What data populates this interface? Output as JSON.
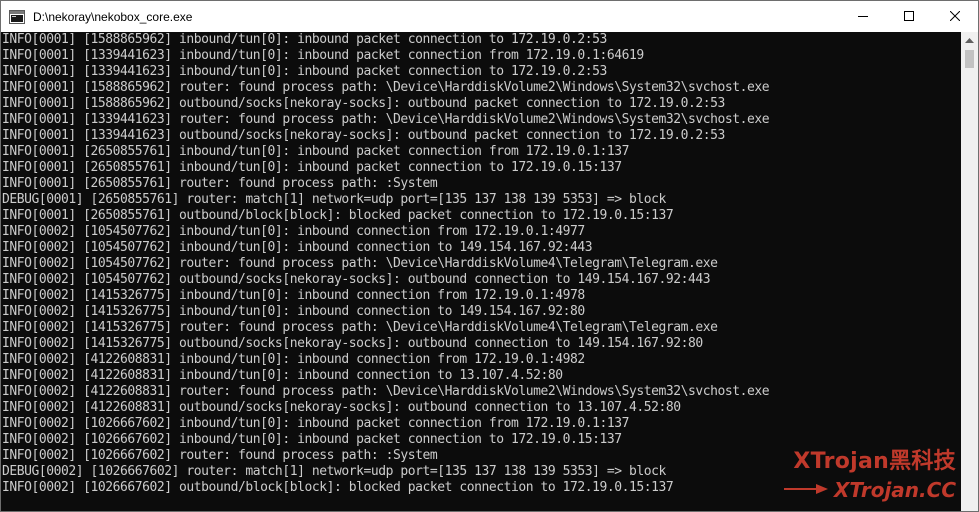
{
  "window": {
    "title": "D:\\nekoray\\nekobox_core.exe",
    "icon": "console-app-icon",
    "controls": [
      "minimize-icon",
      "maximize-icon",
      "close-icon"
    ]
  },
  "console": {
    "lines": [
      "INFO[0001] [1588865962] inbound/tun[0]: inbound packet connection to 172.19.0.2:53",
      "INFO[0001] [1339441623] inbound/tun[0]: inbound packet connection from 172.19.0.1:64619",
      "INFO[0001] [1339441623] inbound/tun[0]: inbound packet connection to 172.19.0.2:53",
      "INFO[0001] [1588865962] router: found process path: \\Device\\HarddiskVolume2\\Windows\\System32\\svchost.exe",
      "INFO[0001] [1588865962] outbound/socks[nekoray-socks]: outbound packet connection to 172.19.0.2:53",
      "INFO[0001] [1339441623] router: found process path: \\Device\\HarddiskVolume2\\Windows\\System32\\svchost.exe",
      "INFO[0001] [1339441623] outbound/socks[nekoray-socks]: outbound packet connection to 172.19.0.2:53",
      "INFO[0001] [2650855761] inbound/tun[0]: inbound packet connection from 172.19.0.1:137",
      "INFO[0001] [2650855761] inbound/tun[0]: inbound packet connection to 172.19.0.15:137",
      "INFO[0001] [2650855761] router: found process path: :System",
      "DEBUG[0001] [2650855761] router: match[1] network=udp port=[135 137 138 139 5353] => block",
      "INFO[0001] [2650855761] outbound/block[block]: blocked packet connection to 172.19.0.15:137",
      "INFO[0002] [1054507762] inbound/tun[0]: inbound connection from 172.19.0.1:4977",
      "INFO[0002] [1054507762] inbound/tun[0]: inbound connection to 149.154.167.92:443",
      "INFO[0002] [1054507762] router: found process path: \\Device\\HarddiskVolume4\\Telegram\\Telegram.exe",
      "INFO[0002] [1054507762] outbound/socks[nekoray-socks]: outbound connection to 149.154.167.92:443",
      "INFO[0002] [1415326775] inbound/tun[0]: inbound connection from 172.19.0.1:4978",
      "INFO[0002] [1415326775] inbound/tun[0]: inbound connection to 149.154.167.92:80",
      "INFO[0002] [1415326775] router: found process path: \\Device\\HarddiskVolume4\\Telegram\\Telegram.exe",
      "INFO[0002] [1415326775] outbound/socks[nekoray-socks]: outbound connection to 149.154.167.92:80",
      "INFO[0002] [4122608831] inbound/tun[0]: inbound connection from 172.19.0.1:4982",
      "INFO[0002] [4122608831] inbound/tun[0]: inbound connection to 13.107.4.52:80",
      "INFO[0002] [4122608831] router: found process path: \\Device\\HarddiskVolume2\\Windows\\System32\\svchost.exe",
      "INFO[0002] [4122608831] outbound/socks[nekoray-socks]: outbound connection to 13.107.4.52:80",
      "INFO[0002] [1026667602] inbound/tun[0]: inbound packet connection from 172.19.0.1:137",
      "INFO[0002] [1026667602] inbound/tun[0]: inbound packet connection to 172.19.0.15:137",
      "INFO[0002] [1026667602] router: found process path: :System",
      "DEBUG[0002] [1026667602] router: match[1] network=udp port=[135 137 138 139 5353] => block",
      "INFO[0002] [1026667602] outbound/block[block]: blocked packet connection to 172.19.0.15:137"
    ]
  },
  "watermark": {
    "title": "XTrojan黑科技",
    "url": "XTrojan.CC",
    "arrow_icon": "arrow-right-icon"
  },
  "colors": {
    "console_bg": "#0c0c0c",
    "console_text": "#cccccc",
    "titlebar_bg": "#ffffff",
    "watermark": "#c0392b",
    "scrollbar_bg": "#f0f0f0"
  }
}
